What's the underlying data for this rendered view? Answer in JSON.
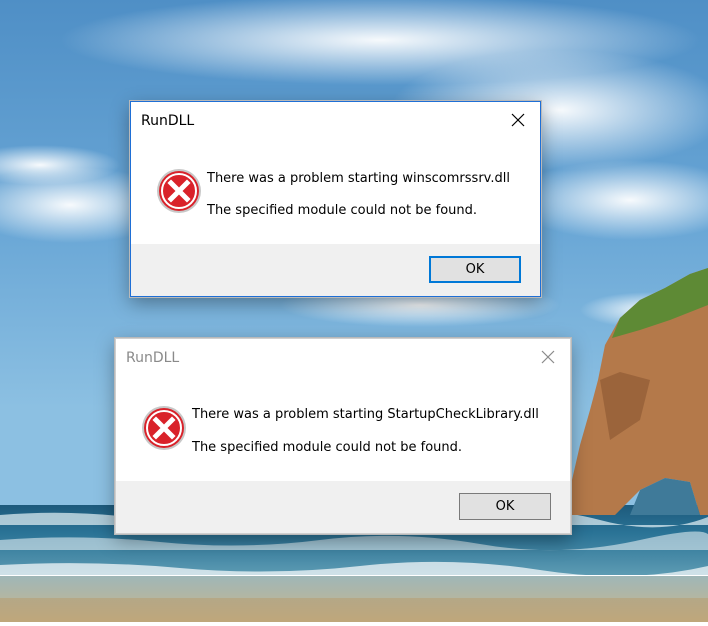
{
  "colors": {
    "accent": "#0078d7",
    "error_red": "#d9222a",
    "footer_bg": "#f0f0f0",
    "button_bg": "#e1e1e1"
  },
  "dialogs": [
    {
      "title": "RunDLL",
      "icon": "error-icon",
      "message_line1": "There was a problem starting winscomrssrv.dll",
      "message_line2": "The specified module could not be found.",
      "ok_label": "OK",
      "active": true
    },
    {
      "title": "RunDLL",
      "icon": "error-icon",
      "message_line1": "There was a problem starting StartupCheckLibrary.dll",
      "message_line2": "The specified module could not be found.",
      "ok_label": "OK",
      "active": false
    }
  ]
}
